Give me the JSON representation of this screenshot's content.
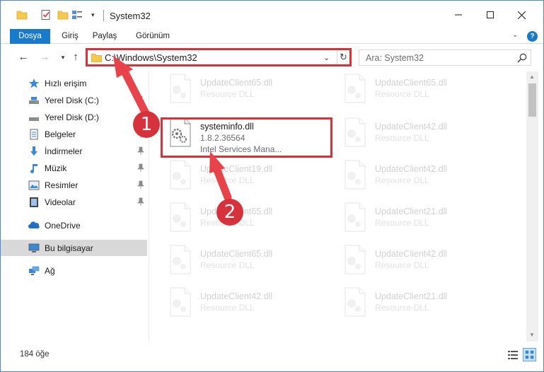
{
  "window": {
    "title": "System32"
  },
  "ribbon": {
    "tabs": [
      "Dosya",
      "Giriş",
      "Paylaş",
      "Görünüm"
    ]
  },
  "address": {
    "path": "C:\\Windows\\System32"
  },
  "search": {
    "placeholder": "Ara: System32"
  },
  "sidebar": {
    "items": [
      {
        "label": "Hızlı erişim",
        "icon": "star-icon",
        "pinned": false
      },
      {
        "label": "Yerel Disk (C:)",
        "icon": "drive-icon",
        "pinned": true
      },
      {
        "label": "Yerel Disk (D:)",
        "icon": "drive-icon",
        "pinned": true
      },
      {
        "label": "Belgeler",
        "icon": "documents-icon",
        "pinned": true
      },
      {
        "label": "İndirmeler",
        "icon": "download-icon",
        "pinned": true
      },
      {
        "label": "Müzik",
        "icon": "music-icon",
        "pinned": true
      },
      {
        "label": "Resimler",
        "icon": "pictures-icon",
        "pinned": true
      },
      {
        "label": "Videolar",
        "icon": "video-icon",
        "pinned": true
      },
      {
        "label": "OneDrive",
        "icon": "cloud-icon",
        "pinned": false
      },
      {
        "label": "Bu bilgisayar",
        "icon": "computer-icon",
        "pinned": false,
        "selected": true
      },
      {
        "label": "Ağ",
        "icon": "network-icon",
        "pinned": false
      }
    ]
  },
  "files": {
    "left": [
      {
        "name": "UpdateClient65.dll",
        "type": "Resource DLL"
      },
      {
        "name": "systeminfo.dll",
        "type": "1.8.2.36564",
        "desc": "Intel Services Mana...",
        "highlighted": true
      },
      {
        "name": "UpdateClient19.dll",
        "type": "Resource DLL"
      },
      {
        "name": "UpdateClient65.dll",
        "type": "Resource DLL"
      },
      {
        "name": "UpdateClient65.dll",
        "type": "Resource DLL"
      },
      {
        "name": "UpdateClient42.dll",
        "type": "Resource DLL"
      }
    ],
    "right": [
      {
        "name": "UpdateClient65.dll",
        "type": "Resource DLL"
      },
      {
        "name": "UpdateClient42.dll",
        "type": "Resource DLL"
      },
      {
        "name": "UpdateClient42.dll",
        "type": "Resource DLL"
      },
      {
        "name": "UpdateClient21.dll",
        "type": "Resource DLL"
      },
      {
        "name": "UpdateClient42.dll",
        "type": "Resource DLL"
      },
      {
        "name": "UpdateClient21.dll",
        "type": "Resource DLL"
      }
    ]
  },
  "status": {
    "count": "184 öğe"
  },
  "callouts": {
    "one": "1",
    "two": "2"
  },
  "colors": {
    "accent": "#1979ca",
    "highlight": "#d6323c"
  }
}
